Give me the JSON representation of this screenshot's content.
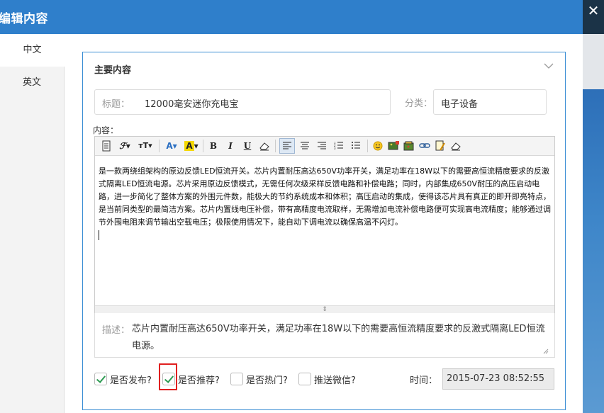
{
  "header": {
    "title": "编辑内容",
    "close_label": "✕"
  },
  "tabs": [
    {
      "label": "中文"
    },
    {
      "label": "英文"
    }
  ],
  "card": {
    "title": "主要内容",
    "title_field": {
      "label": "标题：",
      "value": "12000毫安迷你充电宝"
    },
    "category": {
      "label": "分类：",
      "value": "电子设备"
    },
    "content_label": "内容："
  },
  "toolbar_items": [
    "source-icon",
    "font-family-icon",
    "font-size-icon",
    "font-color-icon",
    "background-color-icon",
    "bold-icon",
    "italic-icon",
    "underline-icon",
    "eraser-icon",
    "align-left-icon",
    "align-center-icon",
    "align-right-icon",
    "ordered-list-icon",
    "unordered-list-icon",
    "emoticon-icon",
    "image-icon",
    "multi-image-icon",
    "link-icon",
    "pagebreak-icon",
    "clear-format-icon"
  ],
  "editor": {
    "body": "是一款两绕组架构的原边反馈LED恒流开关。芯片内置耐压高达650V功率开关，满足功率在18W以下的需要高恒流精度要求的反激式隔离LED恒流电源。芯片采用原边反馈模式，无需任何次级采样反馈电路和补偿电路；同时，内部集成650V耐压的高压启动电路，进一步简化了整体方案的外围元件数，能极大的节约系统成本和体积；高压启动的集成，使得该芯片具有真正的即开即亮特点，是当前同类型的最简洁方案。芯片内置线电压补偿，带有高精度电流取样，无需增加电流补偿电路便可实现高电流精度；能够通过调节外围电阻来调节输出空载电压；极限使用情况下，能自动下调电流以确保高温不闪灯。"
  },
  "description": {
    "label": "描述：",
    "value": "芯片内置耐压高达650V功率开关，满足功率在18W以下的需要高恒流精度要求的反激式隔离LED恒流电源。"
  },
  "options": [
    {
      "label": "是否发布?",
      "checked": true
    },
    {
      "label": "是否推荐?",
      "checked": true
    },
    {
      "label": "是否热门?",
      "checked": false
    },
    {
      "label": "推送微信?",
      "checked": false
    }
  ],
  "time": {
    "label": "时间：",
    "value": "2015-07-23 08:52:55"
  },
  "colors": {
    "header": "#2f7fcb",
    "card_border": "#3b8ed4",
    "check": "#2d9b52",
    "highlight": "#e02020"
  }
}
